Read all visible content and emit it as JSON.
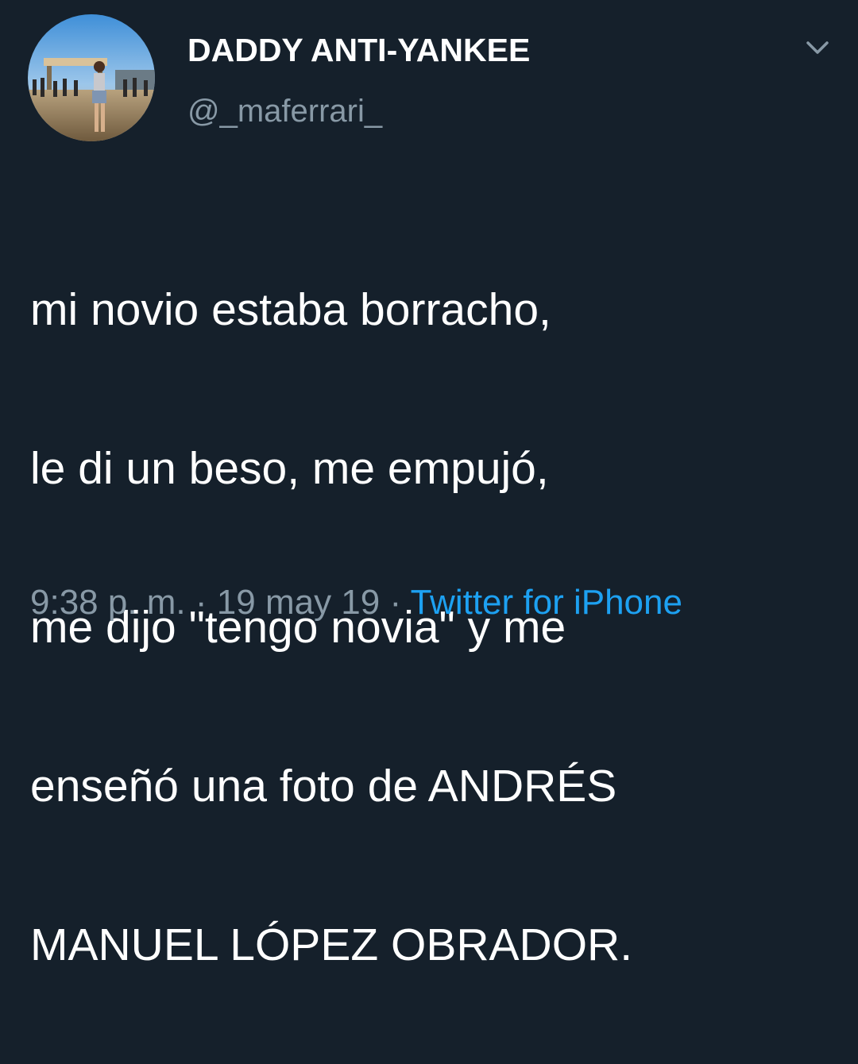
{
  "user": {
    "display_name": "DADDY ANTI-YANKEE",
    "handle": "@_maferrari_"
  },
  "tweet": {
    "lines": [
      "mi novio estaba borracho,",
      "le di un beso, me empujó,",
      "me dijo \"tengo novia\" y me",
      "enseñó una foto de ANDRÉS",
      "MANUEL LÓPEZ OBRADOR."
    ]
  },
  "meta": {
    "time": "9:38 p. m.",
    "separator": "·",
    "date": "19 may 19",
    "source": "Twitter for iPhone"
  },
  "icons": {
    "caret": "chevron-down-icon",
    "avatar": "profile-photo"
  },
  "colors": {
    "background": "#15202b",
    "text": "#ffffff",
    "secondary": "#8899a6",
    "link": "#1da1f2"
  }
}
